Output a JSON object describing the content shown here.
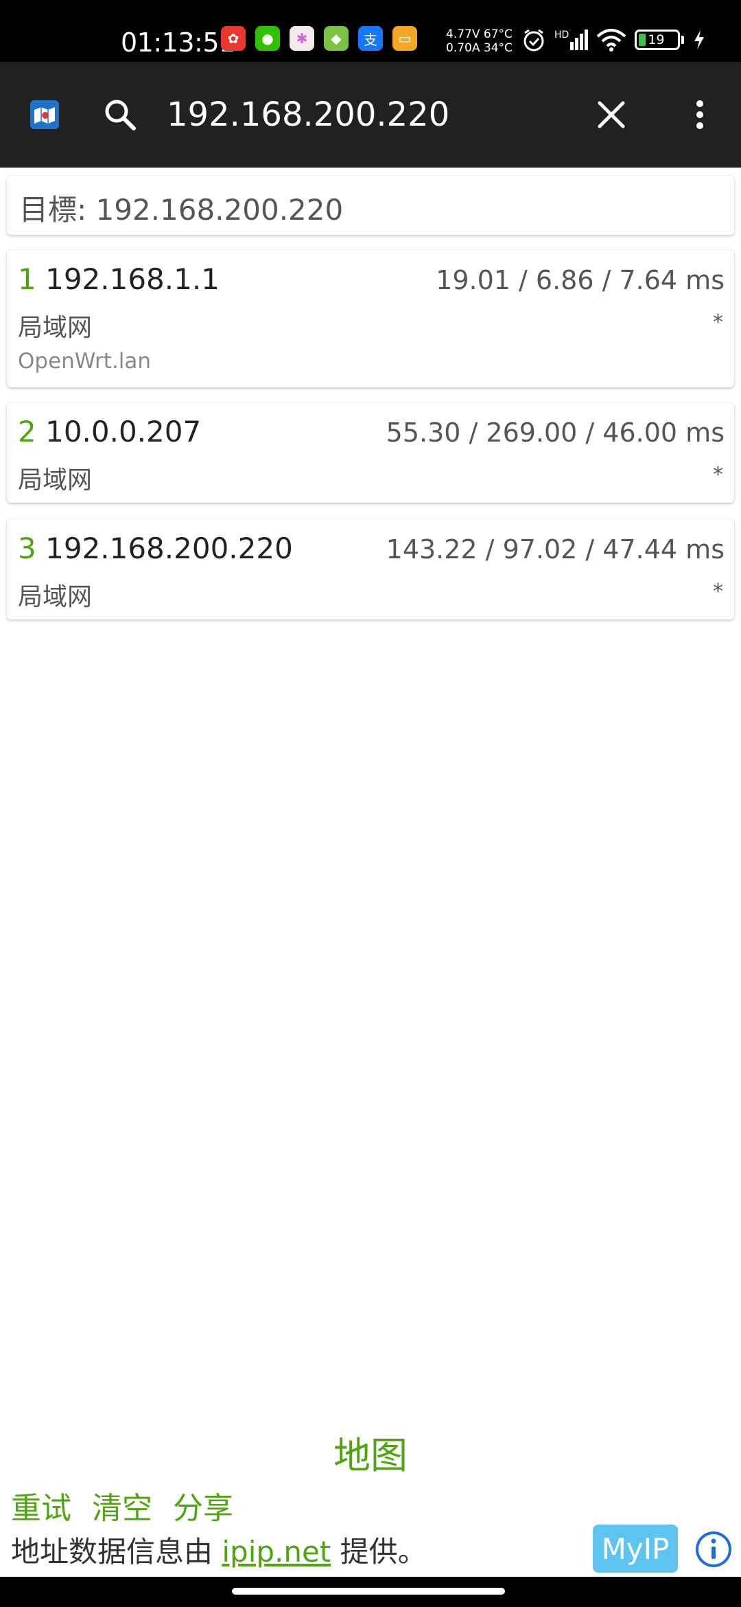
{
  "status_bar": {
    "time": "01:13:51",
    "voltage": "4.77V",
    "current": "0.70A",
    "temp1": "67°C",
    "temp2": "34°C",
    "hd": "HD",
    "battery": "19"
  },
  "toolbar": {
    "search_value": "192.168.200.220"
  },
  "target": {
    "label": "目標: 192.168.200.220"
  },
  "hops": [
    {
      "num": "1",
      "ip": "192.168.1.1",
      "times": "19.01 / 6.86 / 7.64 ms",
      "location": "局域网",
      "star": "*",
      "host": "OpenWrt.lan"
    },
    {
      "num": "2",
      "ip": "10.0.0.207",
      "times": "55.30 / 269.00 / 46.00 ms",
      "location": "局域网",
      "star": "*"
    },
    {
      "num": "3",
      "ip": "192.168.200.220",
      "times": "143.22 / 97.02 / 47.44 ms",
      "location": "局域网",
      "star": "*"
    }
  ],
  "footer": {
    "map_label": "地图",
    "retry_label": "重试",
    "clear_label": "清空",
    "share_label": "分享",
    "provider_prefix": "地址数据信息由 ",
    "provider_link": "ipip.net",
    "provider_suffix": " 提供。",
    "myip_label": "MyIP"
  },
  "colors": {
    "accent": "#4fa510",
    "toolbar": "#212121",
    "myip": "#5ec4ef",
    "info": "#1e6fd9"
  }
}
